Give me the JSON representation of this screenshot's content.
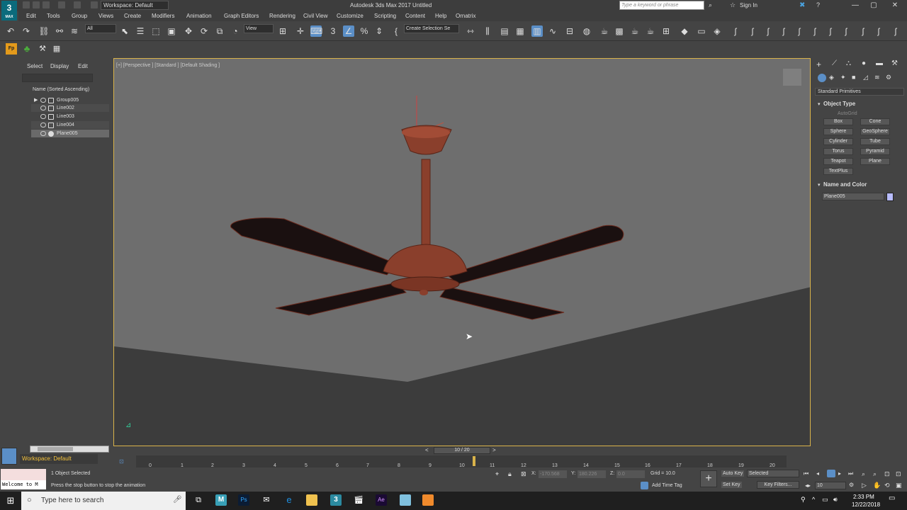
{
  "app": {
    "logo": "3",
    "logo_sub": "MAX",
    "title": "Autodesk 3ds Max 2017     Untitled",
    "workspace": "Workspace: Default",
    "search_placeholder": "Type a keyword or phrase",
    "signin": "Sign In"
  },
  "menus": [
    "Edit",
    "Tools",
    "Group",
    "Views",
    "Create",
    "Modifiers",
    "Animation",
    "Graph Editors",
    "Rendering",
    "Civil View",
    "Customize",
    "Scripting",
    "Content",
    "Help",
    "Ornatrix"
  ],
  "toolbar": {
    "filter": "All",
    "view": "View",
    "selection_set": "Create Selection Se"
  },
  "scene_explorer": {
    "tabs": [
      "Select",
      "Display",
      "Edit"
    ],
    "header": "Name (Sorted Ascending)",
    "items": [
      "Group005",
      "Line002",
      "Line003",
      "Line004",
      "Plane005"
    ],
    "workspace": "Workspace: Default"
  },
  "viewport": {
    "label": "[+] [Perspective ] [Standard ] [Default Shading ]"
  },
  "command_panel": {
    "dropdown": "Standard Primitives",
    "object_type_title": "Object Type",
    "autogrid": "AutoGrid",
    "buttons": [
      "Box",
      "Cone",
      "Sphere",
      "GeoSphere",
      "Cylinder",
      "Tube",
      "Torus",
      "Pyramid",
      "Teapot",
      "Plane",
      "TextPlus"
    ],
    "name_color_title": "Name and Color",
    "object_name": "Plane005"
  },
  "timeline": {
    "frame_display": "10 / 20",
    "ticks": [
      "0",
      "1",
      "2",
      "3",
      "4",
      "5",
      "6",
      "7",
      "8",
      "9",
      "10",
      "11",
      "12",
      "13",
      "14",
      "15",
      "16",
      "17",
      "18",
      "19",
      "20"
    ],
    "current_frame": 10
  },
  "status": {
    "selection": "1 Object Selected",
    "prompt": "Press the stop button to stop the animation",
    "maxscript": "Welcome to M",
    "x_label": "X:",
    "x_val": "-170.568",
    "y_label": "Y:",
    "y_val": "180.226",
    "z_label": "Z:",
    "z_val": "0.0",
    "grid": "Grid = 10.0",
    "add_time_tag": "Add Time Tag",
    "auto_key": "Auto Key",
    "selected": "Selected",
    "set_key": "Set Key",
    "key_filters": "Key Filters...",
    "frame": "10"
  },
  "taskbar": {
    "search": "Type here to search",
    "time": "2:33 PM",
    "date": "12/22/2018"
  },
  "colors": {
    "fan": "#8a3f2c",
    "accent": "#5b8fc7",
    "viewport_border": "#d9b34a",
    "swatch": "#b8bcff"
  }
}
